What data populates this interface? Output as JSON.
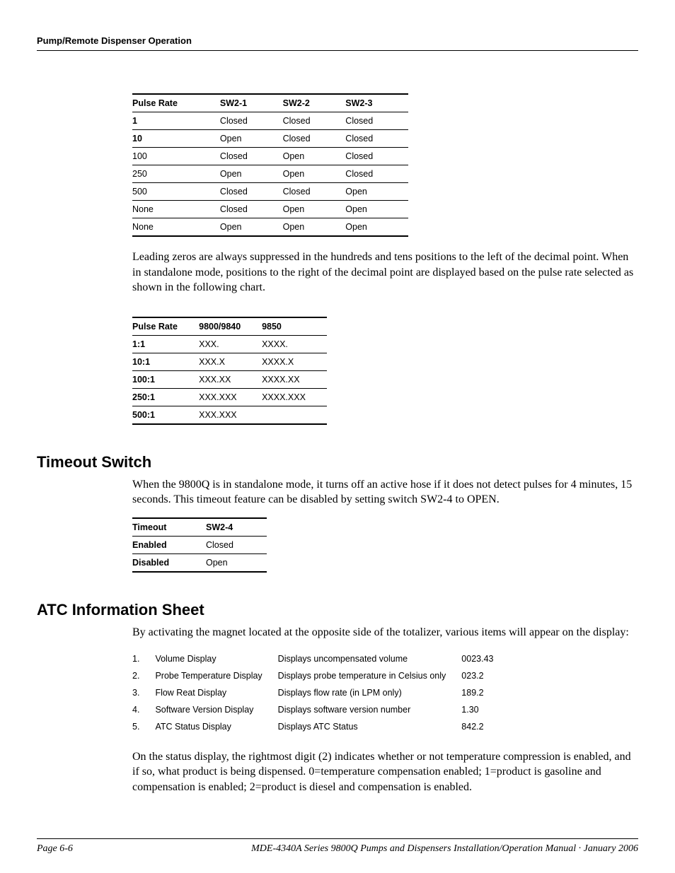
{
  "header": {
    "running_title": "Pump/Remote Dispenser Operation"
  },
  "table1": {
    "headers": [
      "Pulse Rate",
      "SW2-1",
      "SW2-2",
      "SW2-3"
    ],
    "rows": [
      {
        "rate": "1",
        "c1": "Closed",
        "c2": "Closed",
        "c3": "Closed"
      },
      {
        "rate": "10",
        "c1": "Open",
        "c2": "Closed",
        "c3": "Closed"
      },
      {
        "rate": "100",
        "c1": "Closed",
        "c2": "Open",
        "c3": "Closed"
      },
      {
        "rate": "250",
        "c1": "Open",
        "c2": "Open",
        "c3": "Closed"
      },
      {
        "rate": "500",
        "c1": "Closed",
        "c2": "Closed",
        "c3": "Open"
      },
      {
        "rate": "None",
        "c1": "Closed",
        "c2": "Open",
        "c3": "Open"
      },
      {
        "rate": "None",
        "c1": "Open",
        "c2": "Open",
        "c3": "Open"
      }
    ]
  },
  "para1": "Leading zeros are always suppressed in the hundreds and tens positions to the left of the decimal point. When in standalone mode, positions to the right of the decimal point are displayed based on the pulse rate selected as shown in the following chart.",
  "table2": {
    "headers": [
      "Pulse Rate",
      "9800/9840",
      "9850"
    ],
    "rows": [
      {
        "rate": "1:1",
        "a": "XXX.",
        "b": "XXXX."
      },
      {
        "rate": "10:1",
        "a": "XXX.X",
        "b": "XXXX.X"
      },
      {
        "rate": "100:1",
        "a": "XXX.XX",
        "b": "XXXX.XX"
      },
      {
        "rate": "250:1",
        "a": "XXX.XXX",
        "b": "XXXX.XXX"
      },
      {
        "rate": "500:1",
        "a": "XXX.XXX",
        "b": ""
      }
    ]
  },
  "section_timeout": {
    "title": "Timeout Switch",
    "body": "When the 9800Q is in standalone mode, it turns off an active hose if it does not detect pulses for 4 minutes, 15 seconds. This timeout feature can be disabled by setting switch SW2-4 to OPEN.",
    "table": {
      "headers": [
        "Timeout",
        "SW2-4"
      ],
      "rows": [
        {
          "t": "Enabled",
          "v": "Closed"
        },
        {
          "t": "Disabled",
          "v": "Open"
        }
      ]
    }
  },
  "section_atc": {
    "title": "ATC Information Sheet",
    "intro": "By activating the magnet located at the opposite side of the totalizer, various items will appear on the display:",
    "items": [
      {
        "n": "1.",
        "name": "Volume Display",
        "desc": "Displays uncompensated volume",
        "val": "0023.43"
      },
      {
        "n": "2.",
        "name": "Probe Temperature Display",
        "desc": "Displays probe temperature in Celsius only",
        "val": "023.2"
      },
      {
        "n": "3.",
        "name": "Flow Reat Display",
        "desc": "Displays flow rate (in LPM only)",
        "val": "189.2"
      },
      {
        "n": "4.",
        "name": "Software Version Display",
        "desc": "Displays software version number",
        "val": "1.30"
      },
      {
        "n": "5.",
        "name": "ATC Status Display",
        "desc": "Displays ATC Status",
        "val": "842.2"
      }
    ],
    "outro": "On the status display, the rightmost digit (2) indicates whether or not temperature compression is enabled, and if so, what product is being dispensed. 0=temperature compensation enabled; 1=product is gasoline and compensation is enabled; 2=product is diesel and compensation is enabled."
  },
  "footer": {
    "page": "Page 6-6",
    "title": "MDE-4340A Series 9800Q Pumps and Dispensers Installation/Operation Manual · January 2006"
  }
}
